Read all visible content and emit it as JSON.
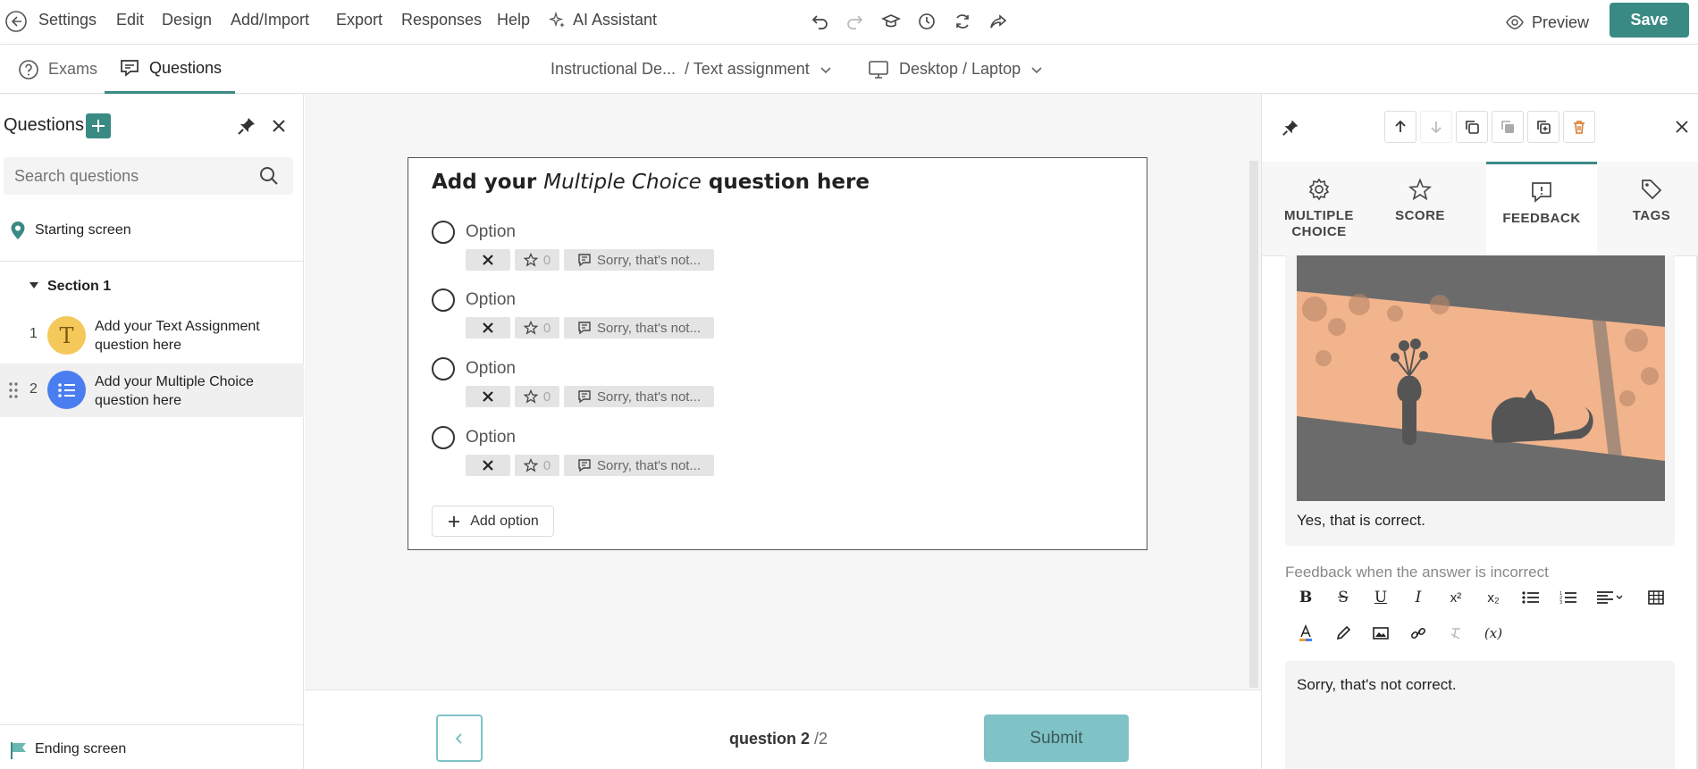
{
  "menubar": {
    "items": [
      "Settings",
      "Edit",
      "Design",
      "Add/Import",
      "Export",
      "Responses",
      "Help"
    ],
    "ai_label": "AI Assistant",
    "preview_label": "Preview",
    "save_label": "Save"
  },
  "tabs": {
    "exams": "Exams",
    "questions": "Questions",
    "breadcrumb": "Instructional De...  / Text assignment",
    "device": "Desktop / Laptop"
  },
  "sidebar": {
    "title": "Questions",
    "search_placeholder": "Search questions",
    "starting_screen": "Starting screen",
    "section": "Section 1",
    "questions": [
      {
        "num": "1",
        "label": "Add your Text Assignment question here",
        "avatar_text": "T"
      },
      {
        "num": "2",
        "label": "Add your Multiple Choice question here"
      }
    ],
    "ending_screen": "Ending screen"
  },
  "question": {
    "title_before": "Add your ",
    "title_italic": "Multiple Choice",
    "title_after": " question here",
    "options": [
      {
        "label": "Option",
        "score": "0",
        "feedback": "Sorry, that's not..."
      },
      {
        "label": "Option",
        "score": "0",
        "feedback": "Sorry, that's not..."
      },
      {
        "label": "Option",
        "score": "0",
        "feedback": "Sorry, that's not..."
      },
      {
        "label": "Option",
        "score": "0",
        "feedback": "Sorry, that's not..."
      }
    ],
    "add_option": "Add option"
  },
  "footer": {
    "question_label": "question 2",
    "question_total": "/2",
    "submit_label": "Submit"
  },
  "panel": {
    "tabs": [
      "MULTIPLE CHOICE",
      "SCORE",
      "FEEDBACK",
      "TAGS"
    ],
    "correct_feedback": "Yes, that is correct.",
    "incorrect_title": "Feedback when the answer is incorrect",
    "incorrect_feedback": "Sorry, that's not correct."
  },
  "colors": {
    "accent": "#3a8a84",
    "submit": "#7fc3c6",
    "avatar_text": "#f5c85a",
    "avatar_mc": "#4a7df0"
  }
}
